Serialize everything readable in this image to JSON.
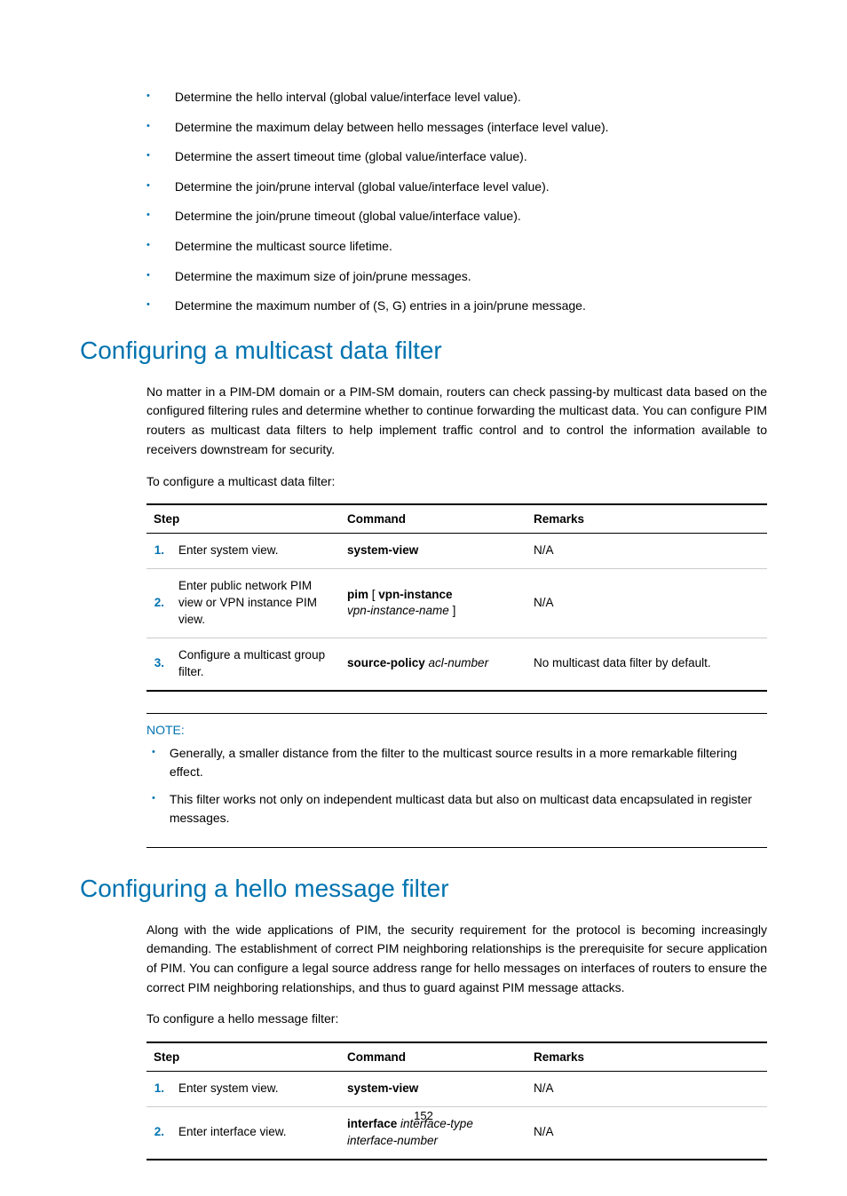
{
  "top_bullets": [
    "Determine the hello interval (global value/interface level value).",
    "Determine the maximum delay between hello messages (interface level value).",
    "Determine the assert timeout time (global value/interface value).",
    "Determine the join/prune interval (global value/interface level value).",
    "Determine the join/prune timeout (global value/interface value).",
    "Determine the multicast source lifetime.",
    "Determine the maximum size of join/prune messages.",
    "Determine the maximum number of (S, G) entries in a join/prune message."
  ],
  "section1": {
    "heading": "Configuring a multicast data filter",
    "para": "No matter in a PIM-DM domain or a PIM-SM domain, routers can check passing-by multicast data based on the configured filtering rules and determine whether to continue forwarding the multicast data. You can configure PIM routers as multicast data filters to help implement traffic control and to control the information available to receivers downstream for security.",
    "intro": "To configure a multicast data filter:",
    "headers": {
      "step": "Step",
      "command": "Command",
      "remarks": "Remarks"
    },
    "rows": [
      {
        "num": "1.",
        "desc": "Enter system view.",
        "cmd_bold": "system-view",
        "cmd_ital": "",
        "remarks": "N/A"
      },
      {
        "num": "2.",
        "desc": "Enter public network PIM view or VPN instance PIM view.",
        "cmd_bold": "pim",
        "cmd_bracket_open": " [ ",
        "cmd_bold2": "vpn-instance",
        "cmd_ital": "vpn-instance-name",
        "cmd_bracket_close": " ]",
        "remarks": "N/A"
      },
      {
        "num": "3.",
        "desc": "Configure a multicast group filter.",
        "cmd_bold": "source-policy",
        "cmd_ital": " acl-number",
        "remarks": "No multicast data filter by default."
      }
    ],
    "note_label": "NOTE:",
    "notes": [
      "Generally, a smaller distance from the filter to the multicast source results in a more remarkable filtering effect.",
      "This filter works not only on independent multicast data but also on multicast data encapsulated in register messages."
    ]
  },
  "section2": {
    "heading": "Configuring a hello message filter",
    "para": "Along with the wide applications of PIM, the security requirement for the protocol is becoming increasingly demanding. The establishment of correct PIM neighboring relationships is the prerequisite for secure application of PIM. You can configure a legal source address range for hello messages on interfaces of routers to ensure the correct PIM neighboring relationships, and thus to guard against PIM message attacks.",
    "intro": "To configure a hello message filter:",
    "headers": {
      "step": "Step",
      "command": "Command",
      "remarks": "Remarks"
    },
    "rows": [
      {
        "num": "1.",
        "desc": "Enter system view.",
        "cmd_bold": "system-view",
        "cmd_ital": "",
        "remarks": "N/A"
      },
      {
        "num": "2.",
        "desc": "Enter interface view.",
        "cmd_bold": "interface",
        "cmd_ital": " interface-type interface-number",
        "remarks": "N/A"
      }
    ]
  },
  "page_number": "152"
}
